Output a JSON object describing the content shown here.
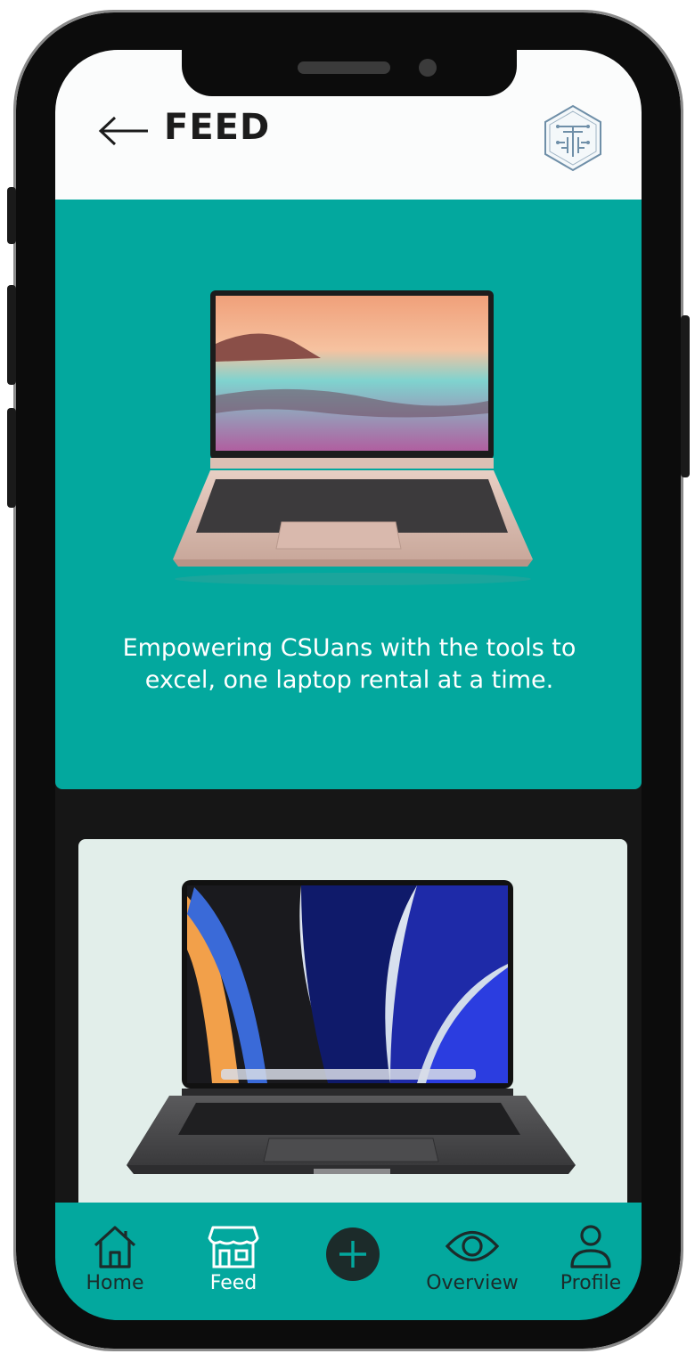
{
  "header": {
    "title": "FEED"
  },
  "hero": {
    "text": "Empowering CSUans with the tools to excel, one laptop rental at a time."
  },
  "tabs": [
    {
      "label": "Home",
      "icon": "home-icon",
      "active": false
    },
    {
      "label": "Feed",
      "icon": "store-icon",
      "active": true
    },
    {
      "label": "",
      "icon": "add-icon",
      "active": false
    },
    {
      "label": "Overview",
      "icon": "eye-icon",
      "active": false
    },
    {
      "label": "Profile",
      "icon": "user-icon",
      "active": false
    }
  ],
  "colors": {
    "accent": "#03a89e",
    "header_bg": "#fbfcfc",
    "card_bg": "#e2eeea",
    "frame": "#0c0c0c"
  }
}
